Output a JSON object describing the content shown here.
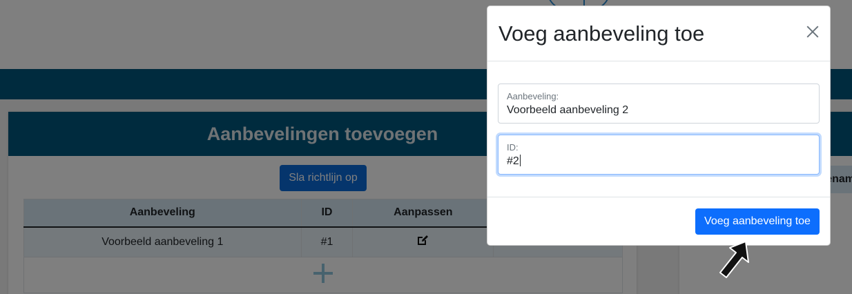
{
  "card": {
    "title": "Aanbevelingen toevoegen",
    "save_button": "Sla richtlijn op"
  },
  "table": {
    "columns": [
      "Aanbeveling",
      "ID",
      "Aanpassen",
      ""
    ],
    "rows": [
      {
        "aanbeveling": "Voorbeeld aanbeveling 1",
        "id": "#1"
      }
    ]
  },
  "side_card": {
    "column_header_partial": "enam"
  },
  "modal": {
    "title": "Voeg aanbeveling toe",
    "fields": {
      "aanbeveling": {
        "label": "Aanbeveling:",
        "value": "Voorbeeld aanbeveling 2"
      },
      "id": {
        "label": "ID:",
        "value": "#2"
      }
    },
    "submit_label": "Voeg aanbeveling toe"
  },
  "icons": {
    "edit": "edit-icon",
    "delete": "trash-icon",
    "add": "plus-icon",
    "close": "close-icon",
    "cursor": "arrow-cursor-icon"
  },
  "colors": {
    "brand_dark": "#00567c",
    "primary": "#0d6efd",
    "table_head": "#d4e7f3"
  }
}
